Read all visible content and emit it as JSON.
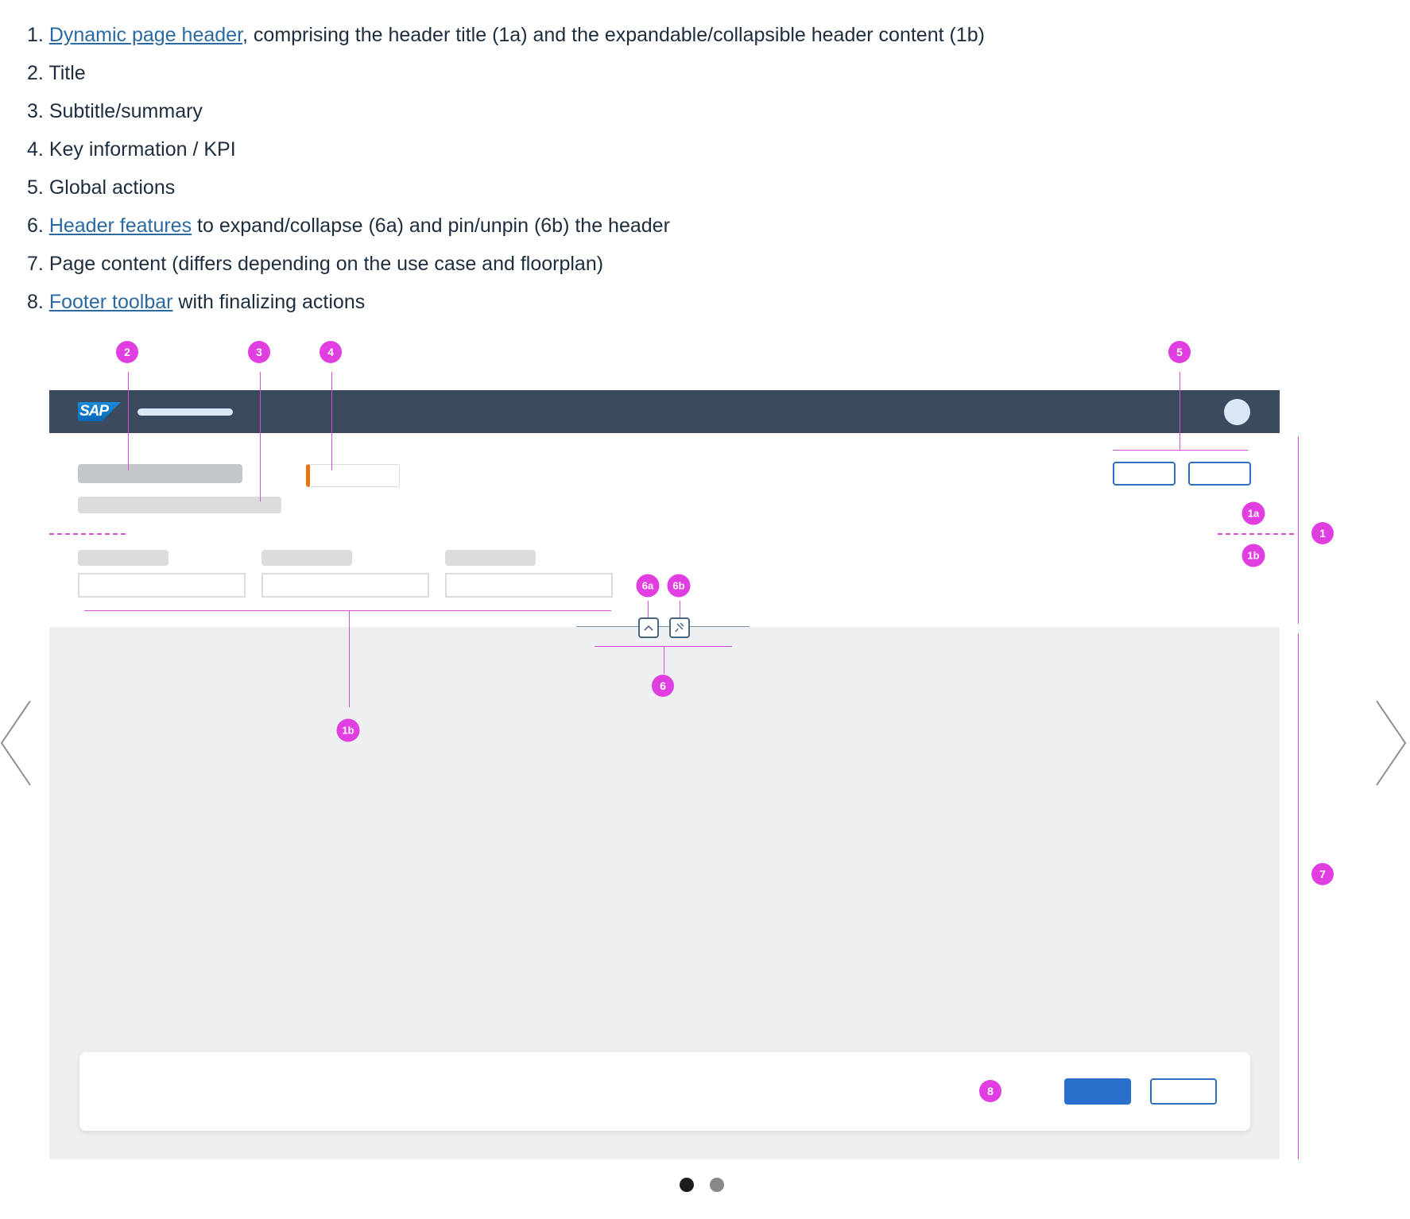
{
  "descriptions": [
    {
      "number": "1.",
      "link": "Dynamic page header",
      "text": ", comprising the header title (1a) and the expandable/collapsible header content (1b)"
    },
    {
      "number": "2.",
      "link": "",
      "text": "Title"
    },
    {
      "number": "3.",
      "link": "",
      "text": "Subtitle/summary"
    },
    {
      "number": "4.",
      "link": "",
      "text": "Key information / KPI"
    },
    {
      "number": "5.",
      "link": "",
      "text": "Global actions"
    },
    {
      "number": "6.",
      "link": "Header features",
      "text": " to expand/collapse (6a) and pin/unpin (6b) the header"
    },
    {
      "number": "7.",
      "link": "",
      "text": "Page content (differs depending on the use case and floorplan)"
    },
    {
      "number": "8.",
      "link": "Footer toolbar",
      "text": " with finalizing actions"
    }
  ],
  "diagram": {
    "shell_logo": "SAP",
    "callouts": {
      "c2": "2",
      "c3": "3",
      "c4": "4",
      "c5": "5",
      "c1": "1",
      "c1a": "1a",
      "c1b_right": "1b",
      "c1b_bottom": "1b",
      "c6a": "6a",
      "c6b": "6b",
      "c6": "6",
      "c7": "7",
      "c8": "8"
    },
    "icons": {
      "collapse": "chevron-up-icon",
      "pin": "pin-icon",
      "prev": "chevron-left-icon",
      "next": "chevron-right-icon"
    },
    "colors": {
      "shellbar": "#3a4a5f",
      "callout": "#e03ee0",
      "kpi_accent": "#e9730c",
      "primary_button": "#2b6fcc",
      "content_background": "#edeff0"
    }
  },
  "carousel": {
    "slides": 2,
    "active_slide": 1
  }
}
